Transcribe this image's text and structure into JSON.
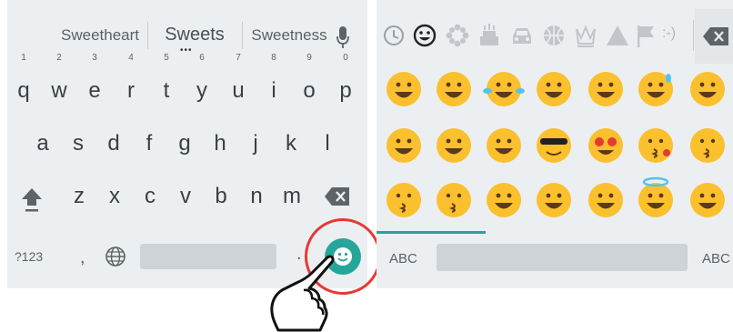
{
  "keyboard": {
    "suggestions": [
      "Sweetheart",
      "Sweets",
      "Sweetness"
    ],
    "suggestion_more": "•••",
    "row1": [
      {
        "letter": "q",
        "hint": "1"
      },
      {
        "letter": "w",
        "hint": "2"
      },
      {
        "letter": "e",
        "hint": "3"
      },
      {
        "letter": "r",
        "hint": "4"
      },
      {
        "letter": "t",
        "hint": "5"
      },
      {
        "letter": "y",
        "hint": "6"
      },
      {
        "letter": "u",
        "hint": "7"
      },
      {
        "letter": "i",
        "hint": "8"
      },
      {
        "letter": "o",
        "hint": "9"
      },
      {
        "letter": "p",
        "hint": "0"
      }
    ],
    "row2": [
      "a",
      "s",
      "d",
      "f",
      "g",
      "h",
      "j",
      "k",
      "l"
    ],
    "row3": [
      "z",
      "x",
      "c",
      "v",
      "b",
      "n",
      "m"
    ],
    "bottom": {
      "symbols_label": "?123",
      "comma": ",",
      "period": "."
    }
  },
  "emoji_panel": {
    "categories": [
      "recent-icon",
      "smileys-icon",
      "nature-icon",
      "food-icon",
      "travel-icon",
      "activity-icon",
      "objects-icon",
      "symbols-icon",
      "flags-icon",
      "emoticons-icon"
    ],
    "emoticon_label": ":-)",
    "abc_left": "ABC",
    "abc_right": "ABC",
    "accent_color": "#26a69a"
  },
  "colors": {
    "panel_bg": "#eceff1",
    "emoji_face": "#fbc02d",
    "highlight_ring": "#e53935",
    "emoji_button": "#26a69a"
  }
}
